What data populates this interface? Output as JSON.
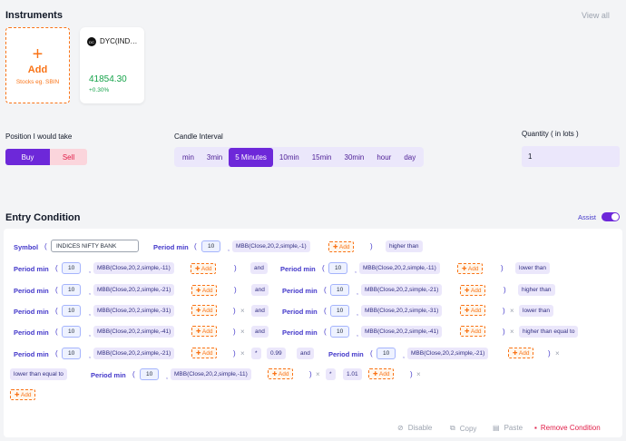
{
  "instruments": {
    "title": "Instruments",
    "view_all": "View all",
    "add_card": {
      "plus": "+",
      "label": "Add",
      "sub": "Stocks eg. SBIN"
    },
    "items": [
      {
        "name": "DYC(IND…",
        "logo": "DC",
        "price": "41854.30",
        "change": "+0.30%"
      }
    ]
  },
  "position": {
    "label": "Position I would take",
    "buy": "Buy",
    "sell": "Sell"
  },
  "candle": {
    "label": "Candle Interval",
    "options": [
      "min",
      "3min",
      "5 Minutes",
      "10min",
      "15min",
      "30min",
      "hour",
      "day"
    ],
    "selected": "5 Minutes"
  },
  "quantity": {
    "label": "Quantity ( in lots )",
    "value": "1"
  },
  "entry": {
    "title": "Entry Condition",
    "assist_label": "Assist",
    "symbol_label": "Symbol",
    "symbol_value": "INDICES NIFTY BANK",
    "period_min": "Period min",
    "add": "Add",
    "and": "and",
    "values": {
      "v10": "10",
      "v099": "0.99",
      "v101": "1.01",
      "star": "*",
      "times": "×"
    },
    "mbb": {
      "m1": "MBB(Close,20,2,simple,-1)",
      "m11": "MBB(Close,20,2,simple,-11)",
      "m21": "MBB(Close,20,2,simple,-21)",
      "m31": "MBB(Close,20,2,simple,-31)",
      "m41": "MBB(Close,20,2,simple,-41)"
    },
    "ops": {
      "higher_than": "higher than",
      "lower_than": "lower than",
      "higher_than_equal_to": "higher than equal to",
      "lower_than_equal_to": "lower than equal to"
    }
  },
  "footer": {
    "disable": "Disable",
    "copy": "Copy",
    "paste": "Paste",
    "remove": "Remove Condition"
  },
  "colors": {
    "accent": "#6d28d9",
    "orange": "#f97316",
    "green": "#16a34a",
    "red": "#e11d48"
  }
}
